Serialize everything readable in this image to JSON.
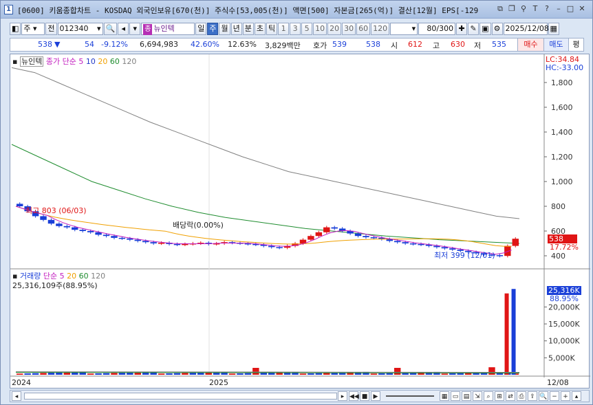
{
  "window": {
    "number": "1",
    "title": "[0600] 키움종합차트 - KOSDAQ 외국인보유[670(천)] 주식수[53,005(천)] 액면[500] 자본금[265(억)] 결산[12월] EPS[-129"
  },
  "toolbar": {
    "period_select": "주",
    "prev_label": "전",
    "code": "012340",
    "stock_badge": "종",
    "stock_name": "뉴인텍",
    "periods": [
      "일",
      "주",
      "월",
      "년",
      "분",
      "초",
      "틱"
    ],
    "active_period": "주",
    "counts": [
      "1",
      "3",
      "5",
      "10",
      "20",
      "30",
      "60",
      "120"
    ],
    "view_count": "80",
    "total_count": "/300",
    "date": "2025/12/08"
  },
  "quote": {
    "price": "538",
    "arrow": "▼",
    "change": "54",
    "change_pct": "-9.12%",
    "volume": "6,694,983",
    "turnover_pct": "42.60%",
    "ratio": "12.63%",
    "amount": "3,829백만",
    "hoga_label": "호가",
    "ask": "539",
    "bid": "538",
    "open_label": "시",
    "open": "612",
    "high_label": "고",
    "high": "630",
    "low_label": "저",
    "low": "535",
    "buy_label": "매수",
    "sell_label": "매도",
    "flat_label": "평"
  },
  "price_panel": {
    "stock_name": "뉴인텍",
    "ma_label": "종가 단순",
    "ma_periods": [
      "5",
      "10",
      "20",
      "60",
      "120"
    ],
    "lc": "LC:34.84",
    "hc": "HC:-33.00",
    "y_ticks": [
      "1,800",
      "1,600",
      "1,400",
      "1,200",
      "1,000",
      "800",
      "600",
      "400"
    ],
    "current_price": "538",
    "current_pct": "17.72%",
    "high_annotation": "최고 803 (06/03)",
    "low_annotation": "최저 399 (12/01)",
    "dividend_annotation": "배당락(0.00%)"
  },
  "volume_panel": {
    "label": "거래량",
    "ma_label": "단순",
    "ma_periods": [
      "5",
      "20",
      "60",
      "120"
    ],
    "current_text": "25,316,109주(88.95%)",
    "current_value": "25,316K",
    "current_pct": "88.95%",
    "y_ticks": [
      "20,000K",
      "15,000K",
      "10,000K",
      "5,000K"
    ]
  },
  "x_axis": {
    "labels": [
      "2024",
      "2025"
    ],
    "end_date": "12/08"
  },
  "colors": {
    "up": "#e01515",
    "down": "#1a3fd8",
    "ma5": "#c21bbf",
    "ma10": "#2238c7",
    "ma20": "#f0a000",
    "ma60": "#1e8c2e",
    "ma120": "#808080"
  },
  "chart_data": {
    "type": "candlestick",
    "title": "뉴인텍",
    "xlabel": "",
    "ylabel": "",
    "ylim": [
      350,
      1950
    ],
    "candles_weekly_close_approx": [
      800,
      760,
      720,
      690,
      660,
      640,
      630,
      610,
      600,
      590,
      570,
      560,
      545,
      540,
      530,
      520,
      510,
      500,
      505,
      495,
      490,
      495,
      500,
      505,
      495,
      500,
      510,
      505,
      500,
      495,
      490,
      480,
      470,
      465,
      480,
      500,
      530,
      560,
      590,
      630,
      620,
      600,
      580,
      560,
      550,
      545,
      535,
      520,
      510,
      500,
      495,
      490,
      480,
      470,
      460,
      450,
      440,
      430,
      420,
      410,
      405,
      399,
      480,
      538
    ],
    "ma120_approx": [
      1920,
      1880,
      1800,
      1720,
      1640,
      1560,
      1480,
      1410,
      1340,
      1270,
      1200,
      1140,
      1080,
      1040,
      1000,
      960,
      920,
      880,
      840,
      800,
      760,
      720,
      700
    ],
    "ma60_approx": [
      1300,
      1200,
      1100,
      1000,
      930,
      860,
      800,
      750,
      710,
      680,
      650,
      620,
      600,
      580,
      560,
      545,
      530,
      520,
      510,
      500
    ],
    "volume": {
      "spike_last": 25316109,
      "spike_pct": "88.95%",
      "ylim": [
        0,
        28000000
      ]
    }
  }
}
